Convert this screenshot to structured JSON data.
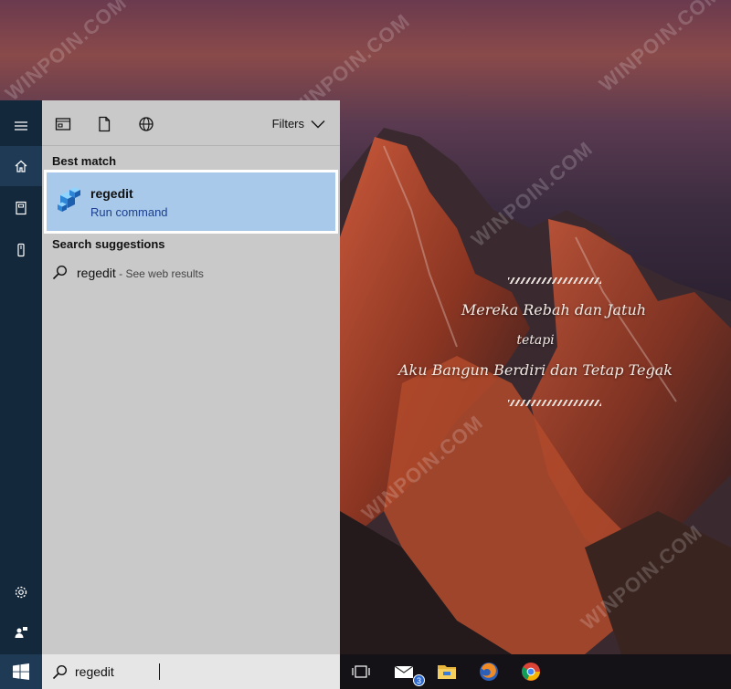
{
  "toolbar": {
    "filters_label": "Filters"
  },
  "sections": {
    "best_match_label": "Best match",
    "suggestions_label": "Search suggestions"
  },
  "best_match": {
    "title": "regedit",
    "subtitle": "Run command"
  },
  "suggestion": {
    "query": "regedit",
    "hint": " - See web results"
  },
  "search": {
    "value": "regedit"
  },
  "taskbar": {
    "mail_badge": "3"
  },
  "wallpaper": {
    "quote_line1": "Mereka Rebah dan Jatuh",
    "quote_line2": "tetapi",
    "quote_line3": "Aku Bangun Berdiri dan Tetap Tegak"
  },
  "watermark": "WINPOIN.COM",
  "colors": {
    "accent": "#a9c9ea",
    "rail": "#14283c",
    "panel": "#c9c9c9",
    "link": "#1a3f8f"
  },
  "icons": {
    "rail": [
      "hamburger-icon",
      "home-icon",
      "notebook-icon",
      "tower-icon",
      "settings-icon",
      "feedback-icon"
    ],
    "toolbar": [
      "apps-icon",
      "document-icon",
      "web-icon"
    ],
    "taskbar": [
      "windows-logo-icon",
      "task-view-icon",
      "mail-icon",
      "file-explorer-icon",
      "firefox-icon",
      "chrome-icon"
    ]
  }
}
